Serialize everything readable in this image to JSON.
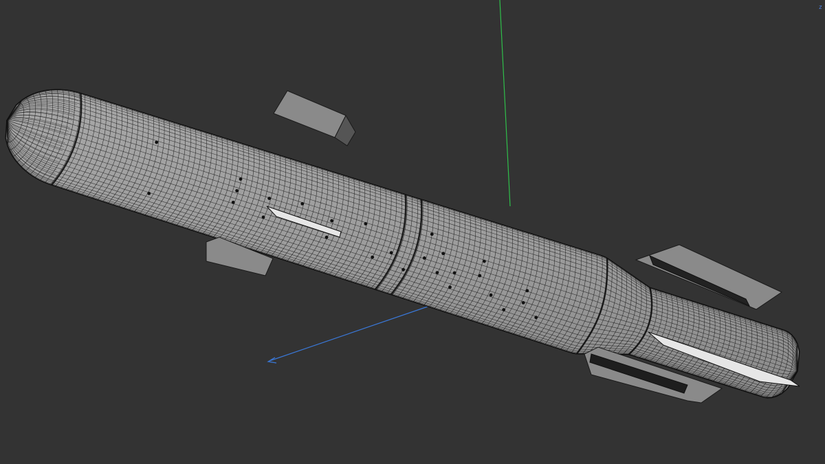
{
  "viewport": {
    "background": "#333333",
    "gizmo_label": "z"
  },
  "axes": {
    "y_color": "#2fbf4a",
    "z_color": "#3a78d8"
  },
  "model": {
    "wireframe_color": "#111111",
    "surface_color": "#9a9a9a",
    "fin_color": "#8a8a8a",
    "wing_color": "#e6e6e6"
  }
}
